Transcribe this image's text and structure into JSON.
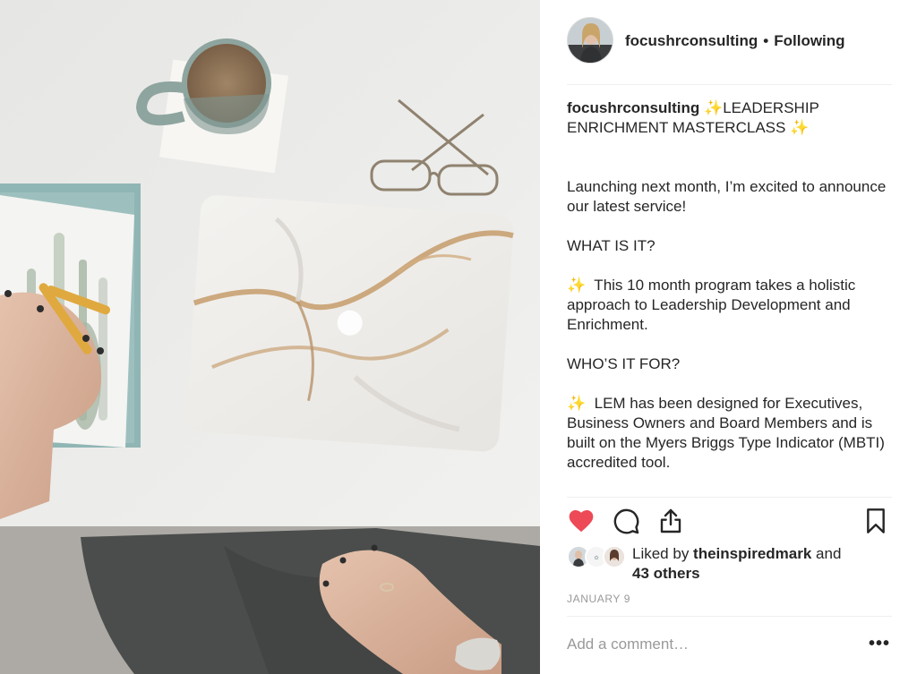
{
  "post": {
    "username": "focushrconsulting",
    "separator": "•",
    "follow_state": "Following",
    "caption": {
      "username": "focushrconsulting",
      "sparkle": "✨",
      "title_part1": "LEADERSHIP",
      "title_part2": "ENRICHMENT MASTERCLASS",
      "para1": "Launching next month, I’m excited to announce our latest service!",
      "heading1": "WHAT IS IT?",
      "para2": "  This 10 month program takes a holistic approach to Leadership Development and Enrichment.",
      "heading2": "WHO’S IT FOR?",
      "para3": "  LEM has been designed for Executives, Business Owners and Board Members and is built on the Myers Briggs Type Indicator (MBTI) accredited tool."
    },
    "likes": {
      "prefix": "Liked by ",
      "user": "theinspiredmark",
      "middle": " and",
      "others": "43 others"
    },
    "date": "JANUARY 9",
    "comment_placeholder": "Add a comment…",
    "more_label": "•••"
  },
  "icons": [
    "heart-icon",
    "comment-icon",
    "share-icon",
    "bookmark-icon",
    "more-icon"
  ],
  "colors": {
    "heart": "#ed4956",
    "text": "#262626",
    "muted": "#999999",
    "divider": "#efefef"
  }
}
